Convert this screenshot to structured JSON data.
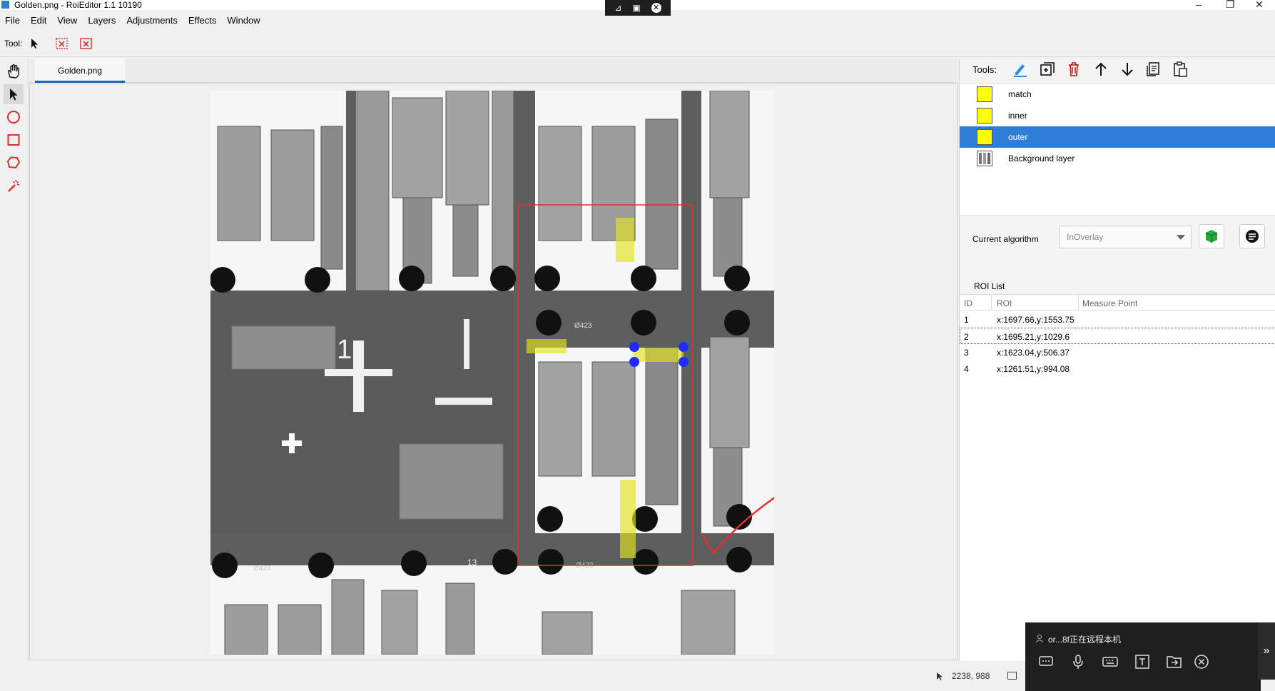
{
  "window": {
    "title": "Golden.png - RoiEditor 1.1 10190",
    "minimize": "–",
    "maximize": "❐",
    "close": "✕"
  },
  "remote_strip": {
    "icon1": "⊿",
    "icon2": "▣",
    "icon3": "✕"
  },
  "menu": [
    "File",
    "Edit",
    "View",
    "Layers",
    "Adjustments",
    "Effects",
    "Window"
  ],
  "toolbar": {
    "tool_label": "Tool:"
  },
  "tab": {
    "label": "Golden.png"
  },
  "right_panel": {
    "tools_label": "Tools:",
    "layers": [
      {
        "name": "match"
      },
      {
        "name": "inner"
      },
      {
        "name": "outer",
        "selected": true
      },
      {
        "name": "Background layer"
      }
    ],
    "algorithm_label": "Current algorithm",
    "algorithm_value": "InOverlay",
    "roi_list_title": "ROI List",
    "roi_columns": [
      "ID",
      "ROI",
      "Measure Point"
    ],
    "roi_rows": [
      {
        "id": "1",
        "roi": "x:1697.66,y:1553.75"
      },
      {
        "id": "2",
        "roi": "x:1695.21,y:1029.6"
      },
      {
        "id": "3",
        "roi": "x:1623.04,y:506.37"
      },
      {
        "id": "4",
        "roi": "x:1261.51,y:994.08"
      }
    ]
  },
  "image_labels": {
    "big_number": "1",
    "mark_a": "Ø423",
    "mark_b": "Ø423",
    "mark_c": "Ø423",
    "mark_d": "13"
  },
  "status": {
    "cursor": "2238, 988"
  },
  "remote_panel": {
    "text": "or...8f正在远程本机",
    "expand": "»"
  },
  "colors": {
    "accent": "#2f7fd8",
    "roi_red": "#e03030",
    "layer_yellow": "#ffff00",
    "handle_blue": "#1f2bff"
  }
}
